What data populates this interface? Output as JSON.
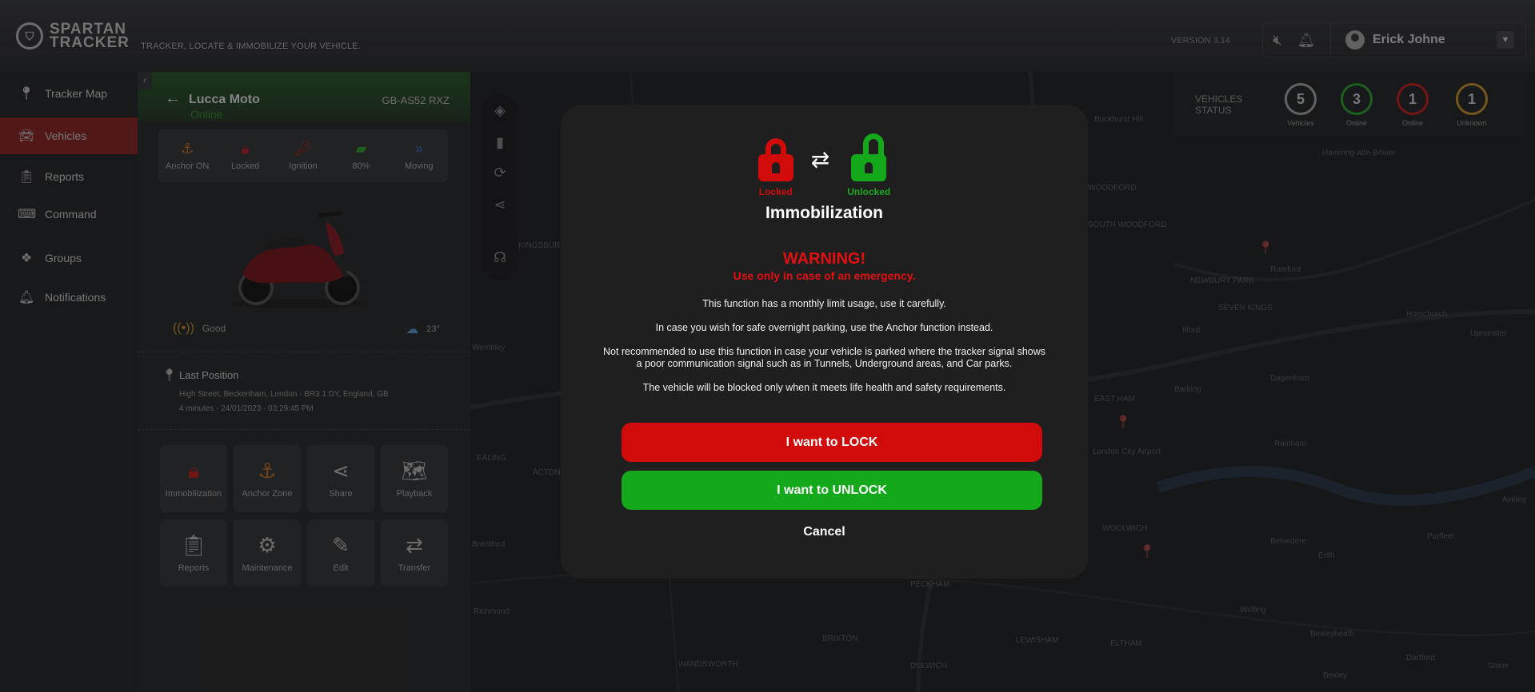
{
  "brand": {
    "logo_line1": "SPARTAN",
    "logo_line2": "TRACKER",
    "tagline": "TRACKER, LOCATE & IMMOBILIZE YOUR VEHICLE."
  },
  "header": {
    "version": "VERSION 3.14",
    "username": "Erick Johne"
  },
  "sidebar": {
    "items": [
      {
        "label": "Tracker Map",
        "icon": "map-pin-icon"
      },
      {
        "label": "Vehicles",
        "icon": "car-icon"
      },
      {
        "label": "Reports",
        "icon": "clipboard-icon"
      },
      {
        "label": "Command",
        "icon": "keyboard-icon"
      },
      {
        "label": "Groups",
        "icon": "network-icon"
      },
      {
        "label": "Notifications",
        "icon": "bell-icon"
      }
    ],
    "active_index": 1
  },
  "vehicle": {
    "name": "Lucca Moto",
    "status": "Online",
    "plate": "GB-AS52 RXZ",
    "stats": [
      {
        "label": "Anchor ON",
        "icon": "anchor-icon",
        "color": "#c9742e"
      },
      {
        "label": "Locked",
        "icon": "lock-icon",
        "color": "#c42525"
      },
      {
        "label": "Ignition",
        "icon": "key-icon",
        "color": "#c42525"
      },
      {
        "label": "80%",
        "icon": "battery-icon",
        "color": "#35a335"
      },
      {
        "label": "Moving",
        "icon": "forward-icon",
        "color": "#3a72d6"
      }
    ],
    "signal": "Good",
    "temperature": "23°",
    "last_position": {
      "title": "Last Position",
      "address": "High Street, Beckenham, London - BR3 1 DY, England, GB",
      "time": "4 minutes - 24/01/2023 - 03:29:45 PM"
    },
    "actions": [
      {
        "label": "Immobilization",
        "icon": "lock-icon"
      },
      {
        "label": "Anchor Zone",
        "icon": "anchor-icon"
      },
      {
        "label": "Share",
        "icon": "share-icon"
      },
      {
        "label": "Playback",
        "icon": "map-icon"
      },
      {
        "label": "Reports",
        "icon": "clipboard-icon"
      },
      {
        "label": "Maintenance",
        "icon": "gear-icon"
      },
      {
        "label": "Edit",
        "icon": "edit-icon"
      },
      {
        "label": "Transfer",
        "icon": "transfer-icon"
      }
    ]
  },
  "vehicles_status": {
    "label": "VEHICLES STATUS",
    "items": [
      {
        "value": "5",
        "caption": "Vehicles",
        "color": "#aaaaaa"
      },
      {
        "value": "3",
        "caption": "Online",
        "color": "#35a335"
      },
      {
        "value": "1",
        "caption": "Online",
        "color": "#c42525"
      },
      {
        "value": "1",
        "caption": "Unknown",
        "color": "#c9952e"
      }
    ]
  },
  "map_labels": [
    "Buckhurst Hill",
    "Havering-atte-Bower",
    "WOODFORD",
    "SOUTH WOODFORD",
    "Romford",
    "Ilford",
    "Homchurch",
    "Upminster",
    "Wembley",
    "Dagenham",
    "EAST HAM",
    "Barking",
    "Rainham",
    "London City Airport",
    "WOOLWICH",
    "Belvedere",
    "Erith",
    "Aveley",
    "Purfleet",
    "Brentford",
    "EALING",
    "ACTON",
    "PECKHAM",
    "BRIXTON",
    "LEWISHAM",
    "ELTHAM",
    "Welling",
    "Bexleyheath",
    "Bexley",
    "Dartford",
    "Stone",
    "Richmond",
    "WANDSWORTH",
    "DULWICH",
    "NEWBURY PARK",
    "SEVEN KINGS",
    "KINGSBURY"
  ],
  "modal": {
    "locked_caption": "Locked",
    "unlocked_caption": "Unlocked",
    "title": "Immobilization",
    "warning": "WARNING!",
    "warning_sub": "Use only in case of an emergency.",
    "paragraphs": [
      "This function has a monthly limit usage, use it carefully.",
      "In case you wish for safe overnight parking, use the Anchor function instead.",
      "Not recommended to use this function in case your vehicle is parked where the tracker signal shows a poor communication signal such as in Tunnels, Underground areas, and Car parks.",
      "The vehicle will be blocked only when it meets life health and safety requirements."
    ],
    "lock_button": "I want to LOCK",
    "unlock_button": "I want to UNLOCK",
    "cancel_button": "Cancel",
    "colors": {
      "lock": "#d10a0a",
      "unlock": "#14a81b"
    }
  }
}
